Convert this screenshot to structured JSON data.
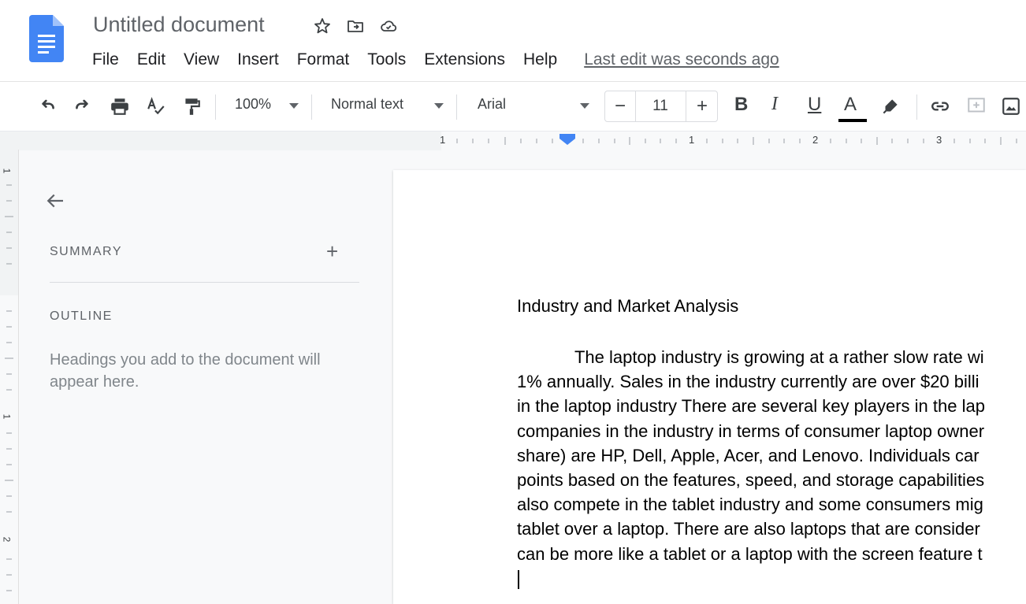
{
  "app": {
    "title": "Untitled document",
    "last_edit": "Last edit was seconds ago",
    "accent_color": "#4285f4"
  },
  "menu": {
    "items": [
      "File",
      "Edit",
      "View",
      "Insert",
      "Format",
      "Tools",
      "Extensions",
      "Help"
    ]
  },
  "toolbar": {
    "zoom": "100%",
    "style": "Normal text",
    "font": "Arial",
    "font_size": "11",
    "size_minus": "−",
    "size_plus": "+",
    "bold": "B",
    "italic": "I",
    "underline": "U",
    "text_color": "A",
    "icons": [
      "undo-icon",
      "redo-icon",
      "print-icon",
      "spellcheck-icon",
      "paint-format-icon",
      "highlighter-icon",
      "link-icon",
      "comment-icon",
      "image-icon"
    ]
  },
  "ruler": {
    "numbers": [
      "1",
      "1",
      "2",
      "3"
    ],
    "vertical_numbers": [
      "1",
      "1",
      "2"
    ]
  },
  "outline_panel": {
    "summary_label": "SUMMARY",
    "summary_add": "+",
    "outline_label": "OUTLINE",
    "outline_hint": "Headings you add to the document will appear here."
  },
  "document": {
    "heading": "Industry and Market Analysis",
    "paragraph_lines": [
      "            The laptop industry is growing at a rather slow rate wi",
      "1% annually.  Sales in the industry currently are over $20 billi",
      "in the laptop industry There are several key players in the lap",
      "companies in the industry in terms of consumer laptop owner",
      "share) are HP, Dell, Apple, Acer, and Lenovo.  Individuals car",
      "points based on the features, speed, and storage capabilities",
      "also compete in the tablet industry and some consumers mig",
      "tablet over a laptop.  There are also laptops that are consider",
      "can be more like a tablet or a laptop with the screen feature t"
    ]
  }
}
